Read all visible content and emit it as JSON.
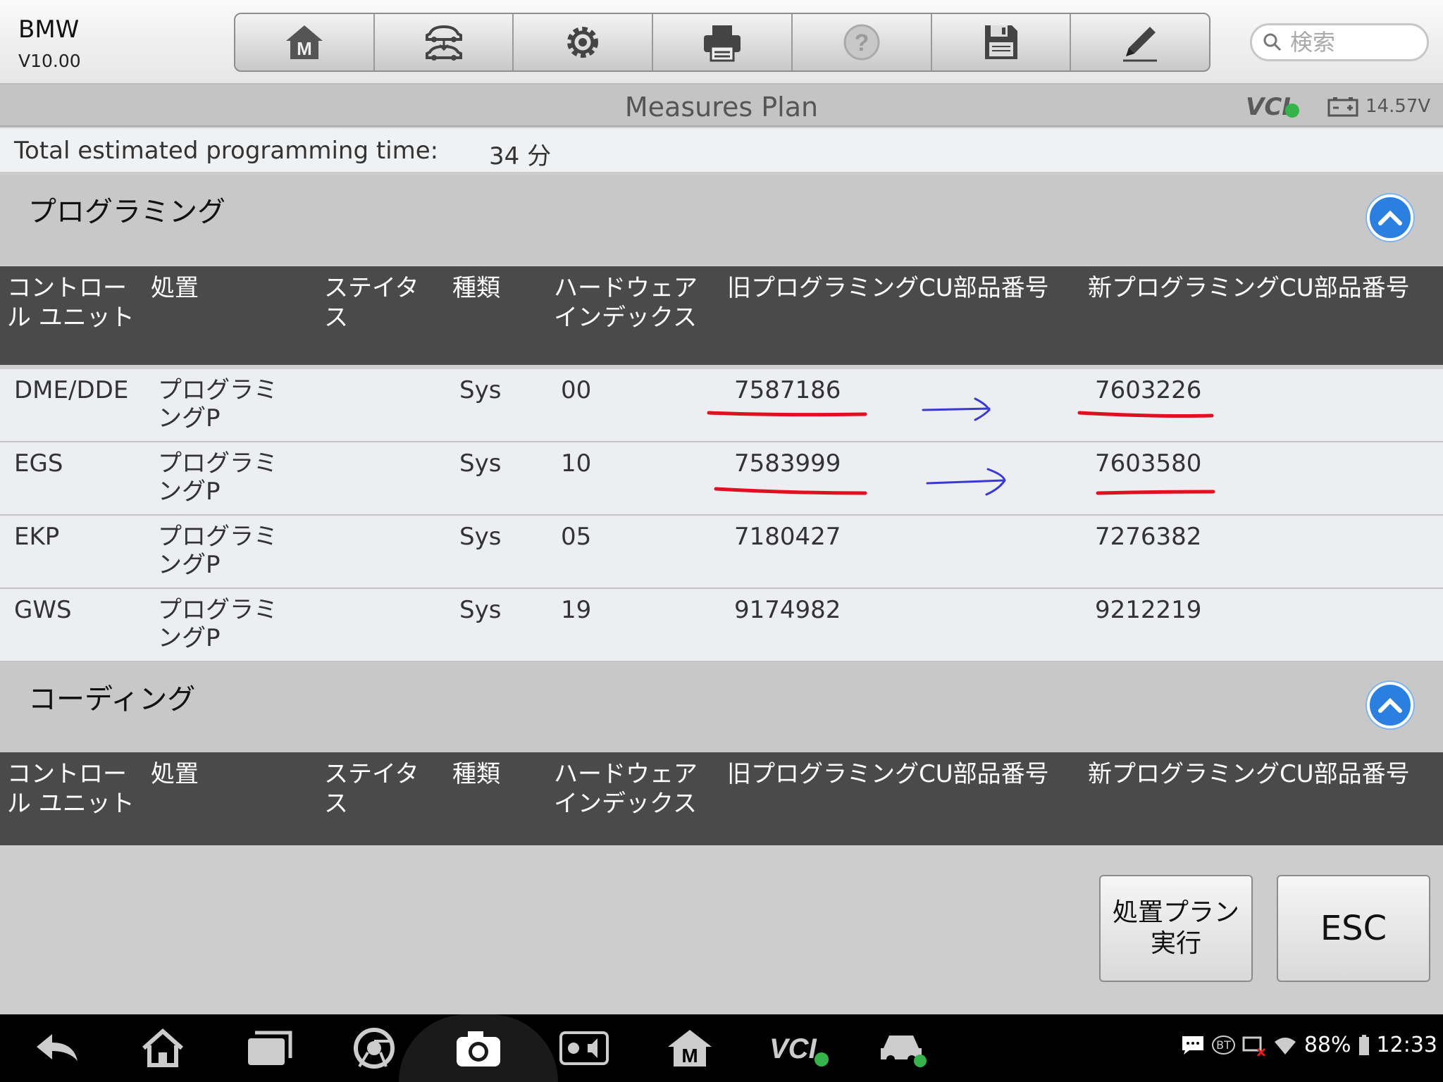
{
  "app": {
    "brand": "BMW",
    "version": "V10.00"
  },
  "toolbar": {
    "buttons": [
      "home",
      "vehicle-swap",
      "settings",
      "print",
      "help",
      "save",
      "edit"
    ]
  },
  "search": {
    "placeholder": "検索"
  },
  "title": "Measures Plan",
  "status": {
    "vcl": "VCI",
    "battery_voltage": "14.57V"
  },
  "estimate": {
    "label": "Total estimated programming time:",
    "value": "34 分"
  },
  "columns": [
    "コントロール ユニット",
    "処置",
    "ステイタス",
    "種類",
    "ハードウェアインデックス",
    "旧プログラミングCU部品番号",
    "新プログラミングCU部品番号"
  ],
  "programming": {
    "title": "プログラミング",
    "rows": [
      {
        "unit": "DME/DDE",
        "action": "プログラミングP",
        "status": "",
        "type": "Sys",
        "hw": "00",
        "old": "7587186",
        "new": "7603226"
      },
      {
        "unit": "EGS",
        "action": "プログラミングP",
        "status": "",
        "type": "Sys",
        "hw": "10",
        "old": "7583999",
        "new": "7603580"
      },
      {
        "unit": "EKP",
        "action": "プログラミングP",
        "status": "",
        "type": "Sys",
        "hw": "05",
        "old": "7180427",
        "new": "7276382"
      },
      {
        "unit": "GWS",
        "action": "プログラミングP",
        "status": "",
        "type": "Sys",
        "hw": "19",
        "old": "9174982",
        "new": "9212219"
      }
    ]
  },
  "coding": {
    "title": "コーディング"
  },
  "actions": {
    "execute": "処置プラン実行",
    "esc": "ESC"
  },
  "system_bar": {
    "battery": "88%",
    "time": "12:33",
    "bt": "BT"
  },
  "colors": {
    "header_dark": "#4a4a4a",
    "accent_blue": "#2a7fe0",
    "underline_red": "#e01020",
    "arrow_blue": "#3a3ad0"
  }
}
